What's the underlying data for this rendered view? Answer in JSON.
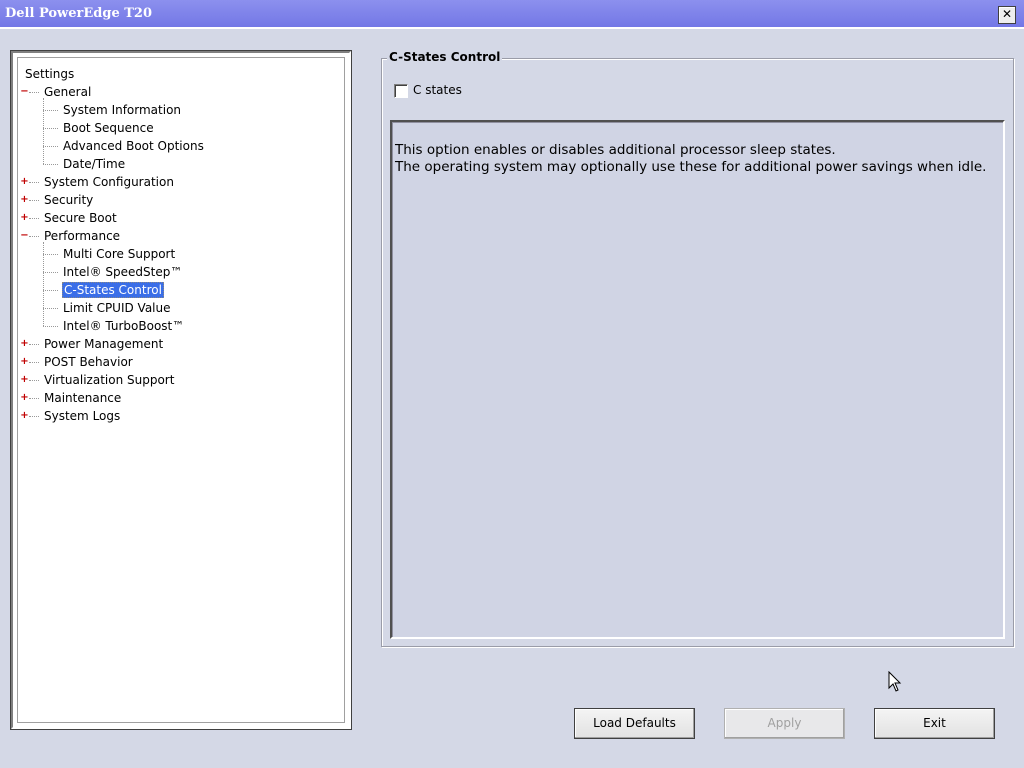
{
  "window": {
    "title": "Dell PowerEdge T20",
    "close_glyph": "✕"
  },
  "tree": {
    "root": "Settings",
    "items": [
      {
        "label": "General",
        "expander": "−"
      },
      {
        "label": "System Information"
      },
      {
        "label": "Boot Sequence"
      },
      {
        "label": "Advanced Boot Options"
      },
      {
        "label": "Date/Time"
      },
      {
        "label": "System Configuration",
        "expander": "+"
      },
      {
        "label": "Security",
        "expander": "+"
      },
      {
        "label": "Secure Boot",
        "expander": "+"
      },
      {
        "label": "Performance",
        "expander": "−"
      },
      {
        "label": "Multi Core Support"
      },
      {
        "label": "Intel® SpeedStep™"
      },
      {
        "label": "C-States Control",
        "selected": true
      },
      {
        "label": "Limit CPUID Value"
      },
      {
        "label": "Intel® TurboBoost™"
      },
      {
        "label": "Power Management",
        "expander": "+"
      },
      {
        "label": "POST Behavior",
        "expander": "+"
      },
      {
        "label": "Virtualization Support",
        "expander": "+"
      },
      {
        "label": "Maintenance",
        "expander": "+"
      },
      {
        "label": "System Logs",
        "expander": "+"
      }
    ]
  },
  "panel": {
    "title": "C-States Control",
    "checkbox_label": "C states",
    "checked": false,
    "description": [
      "This option enables or disables additional processor sleep states.",
      "The operating system may optionally use these for additional power savings when idle."
    ]
  },
  "buttons": {
    "load_defaults": "Load Defaults",
    "apply": "Apply",
    "exit": "Exit"
  }
}
